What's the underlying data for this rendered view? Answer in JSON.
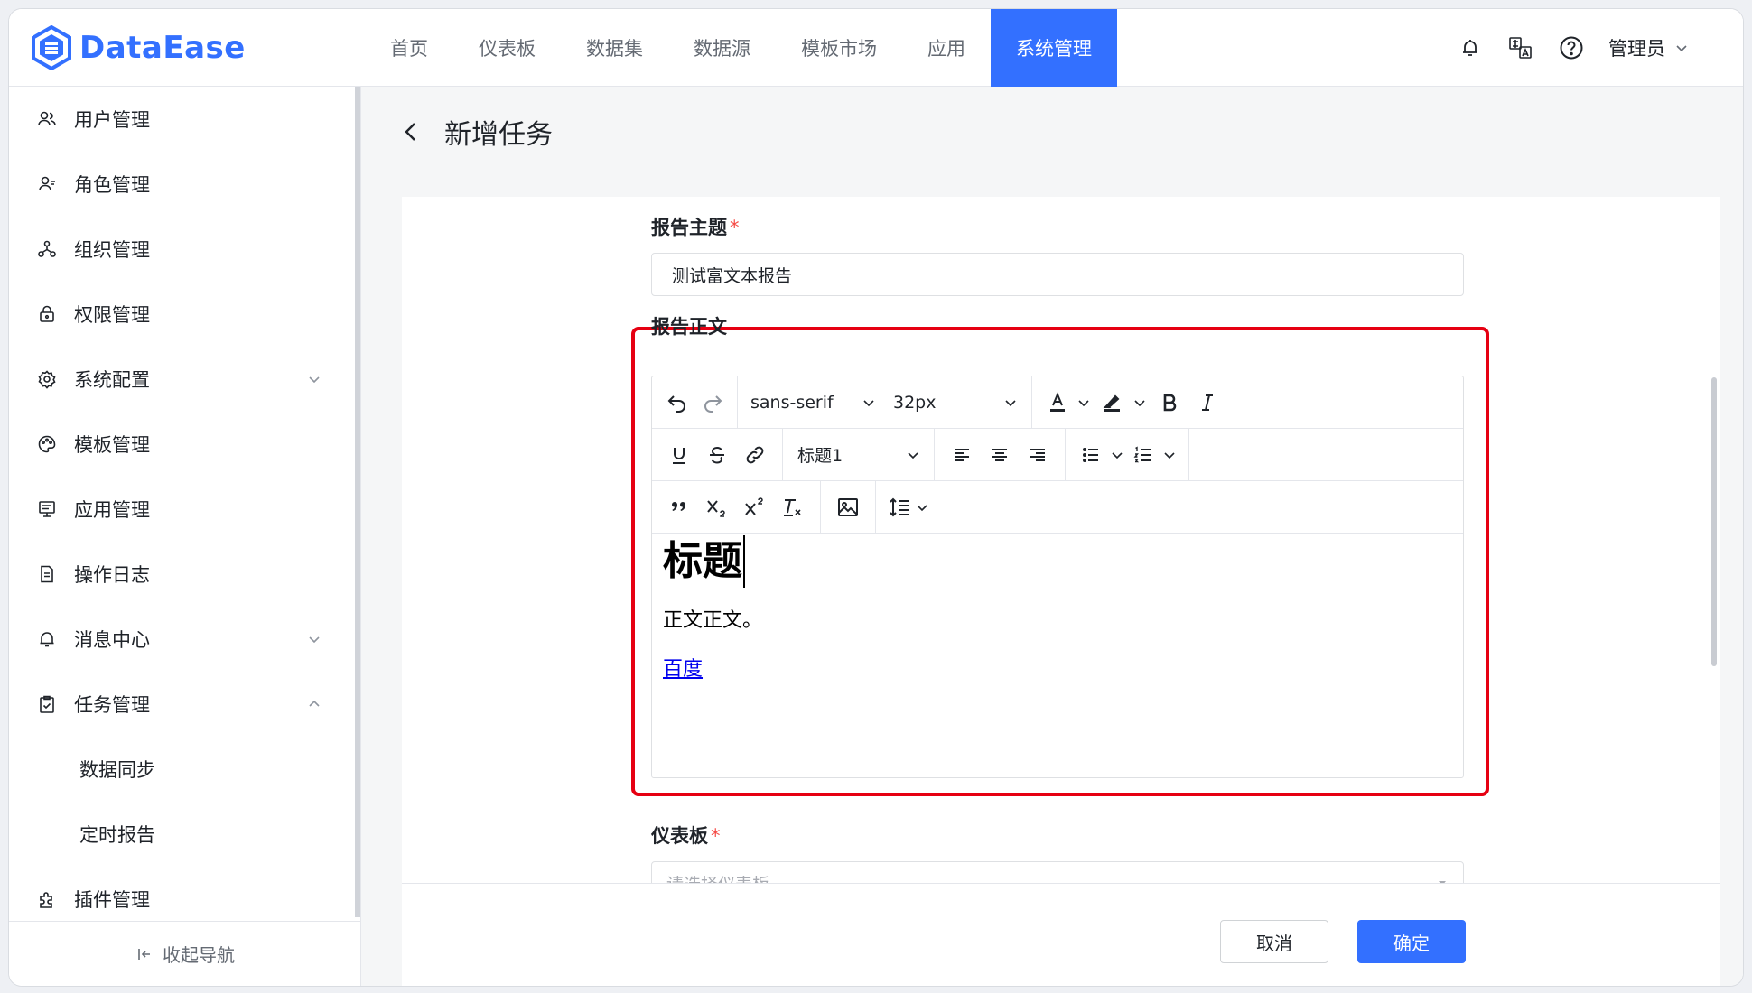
{
  "app": {
    "name": "DataEase",
    "brand_color": "#3370ff"
  },
  "nav": {
    "items": [
      {
        "label": "首页"
      },
      {
        "label": "仪表板"
      },
      {
        "label": "数据集"
      },
      {
        "label": "数据源"
      },
      {
        "label": "模板市场"
      },
      {
        "label": "应用"
      },
      {
        "label": "系统管理",
        "active": true
      }
    ]
  },
  "header_right": {
    "user": "管理员",
    "icons": [
      "bell-icon",
      "translate-icon",
      "help-icon"
    ]
  },
  "sidebar": {
    "items": [
      {
        "label": "用户管理",
        "icon": "user-icon"
      },
      {
        "label": "角色管理",
        "icon": "role-icon"
      },
      {
        "label": "组织管理",
        "icon": "org-icon"
      },
      {
        "label": "权限管理",
        "icon": "lock-icon"
      },
      {
        "label": "系统配置",
        "icon": "gear-icon",
        "expandable": true,
        "expanded": false
      },
      {
        "label": "模板管理",
        "icon": "palette-icon"
      },
      {
        "label": "应用管理",
        "icon": "app-icon"
      },
      {
        "label": "操作日志",
        "icon": "log-icon"
      },
      {
        "label": "消息中心",
        "icon": "bell-icon",
        "expandable": true,
        "expanded": false
      },
      {
        "label": "任务管理",
        "icon": "task-icon",
        "expandable": true,
        "expanded": true
      },
      {
        "label": "插件管理",
        "icon": "plugin-icon"
      }
    ],
    "subitems": [
      {
        "label": "数据同步"
      },
      {
        "label": "定时报告"
      }
    ],
    "collapse_label": "收起导航"
  },
  "page": {
    "title": "新增任务"
  },
  "form": {
    "subject_label": "报告主题",
    "subject_value": "测试富文本报告",
    "body_label": "报告正文",
    "dashboard_label": "仪表板",
    "dashboard_placeholder": "请选择仪表板",
    "required_mark": "*"
  },
  "editor": {
    "font_family": "sans-serif",
    "font_size": "32px",
    "heading": "标题1",
    "content": {
      "heading": "标题",
      "paragraph": "正文正文。",
      "link": "百度"
    },
    "highlight_color": "#e60012"
  },
  "footer": {
    "cancel": "取消",
    "confirm": "确定"
  }
}
